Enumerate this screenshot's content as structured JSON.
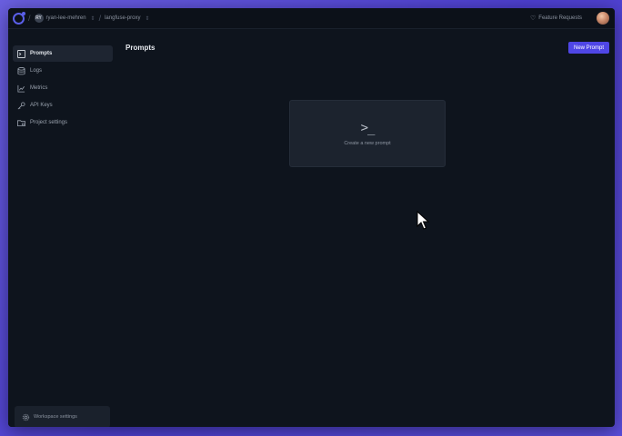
{
  "topbar": {
    "workspace_initials": "RY",
    "workspace_name": "ryan-lee-mehren",
    "project_name": "langfuse-proxy",
    "feature_requests": "Feature Requests"
  },
  "sidebar": {
    "items": [
      {
        "label": "Prompts",
        "icon": "terminal-icon"
      },
      {
        "label": "Logs",
        "icon": "database-icon"
      },
      {
        "label": "Metrics",
        "icon": "chart-icon"
      },
      {
        "label": "API Keys",
        "icon": "key-icon"
      },
      {
        "label": "Project settings",
        "icon": "folder-gear-icon"
      }
    ],
    "workspace_settings": "Workspace settings"
  },
  "main": {
    "title": "Prompts",
    "new_prompt_button": "New Prompt",
    "empty_card": {
      "icon_glyph": ">_",
      "label": "Create a new prompt"
    }
  },
  "colors": {
    "accent": "#4f46e5",
    "background": "#0e141d",
    "frame": "#5a4ddb"
  }
}
